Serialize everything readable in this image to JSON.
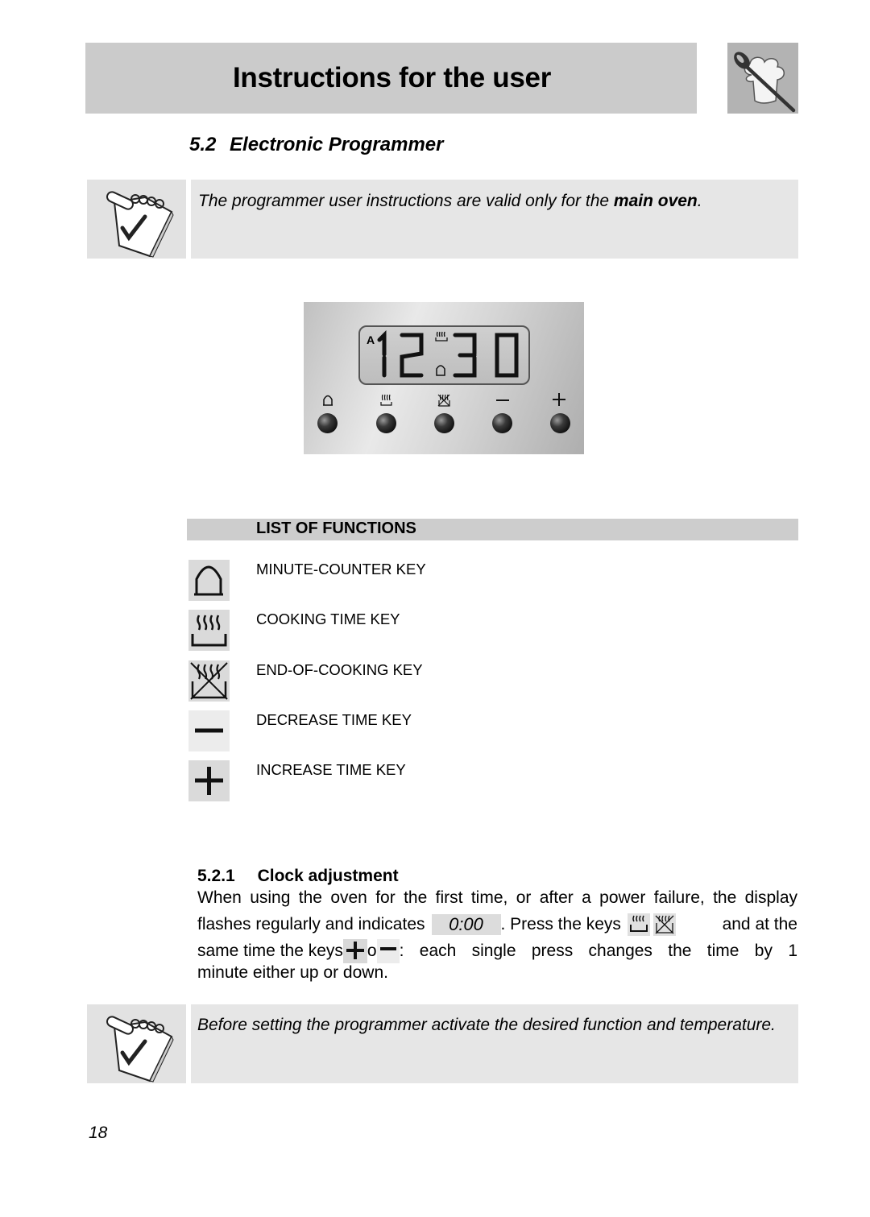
{
  "header": {
    "title": "Instructions for the user",
    "logo_icon": "chef-hat-spoon-icon"
  },
  "section": {
    "number": "5.2",
    "title": "Electronic Programmer"
  },
  "notes": [
    {
      "icon": "notepad-check-icon",
      "text_before": "The programmer user instructions are valid only for the ",
      "text_bold": "main oven",
      "text_after": "."
    },
    {
      "icon": "notepad-check-icon",
      "text": "Before setting the programmer activate the desired function and temperature."
    }
  ],
  "programmer_panel": {
    "display": {
      "mode_indicator": "A",
      "digits": [
        "1",
        "2",
        "3",
        "0"
      ],
      "time": "12:30",
      "indicators": [
        "cooking-time-icon",
        "bell-icon"
      ]
    },
    "buttons": [
      {
        "icon": "bell-icon",
        "name": "minute-counter"
      },
      {
        "icon": "cooking-time-icon",
        "name": "cooking-time"
      },
      {
        "icon": "end-of-cooking-icon",
        "name": "end-of-cooking"
      },
      {
        "icon": "minus-icon",
        "name": "decrease"
      },
      {
        "icon": "plus-icon",
        "name": "increase"
      }
    ]
  },
  "list_of_functions": {
    "title": "LIST OF FUNCTIONS",
    "items": [
      {
        "icon": "bell-icon",
        "label": "MINUTE-COUNTER KEY"
      },
      {
        "icon": "cooking-time-icon",
        "label": "COOKING TIME KEY"
      },
      {
        "icon": "end-of-cooking-icon",
        "label": "END-OF-COOKING KEY"
      },
      {
        "icon": "minus-icon",
        "label": "DECREASE TIME KEY"
      },
      {
        "icon": "plus-icon",
        "label": "INCREASE TIME KEY"
      }
    ]
  },
  "clock_adjustment": {
    "number": "5.2.1",
    "title": "Clock adjustment",
    "line1": "When using the oven for the first time, or after a power failure, the display",
    "line2a": "flashes regularly and indicates",
    "display_value": "0:00",
    "line2b": ". Press the keys",
    "line2c": "and at the",
    "line3a": "same time the keys",
    "line3b": "o",
    "line3c": ": each single press changes the time by 1",
    "line4": "minute either up or down."
  },
  "page_number": "18"
}
